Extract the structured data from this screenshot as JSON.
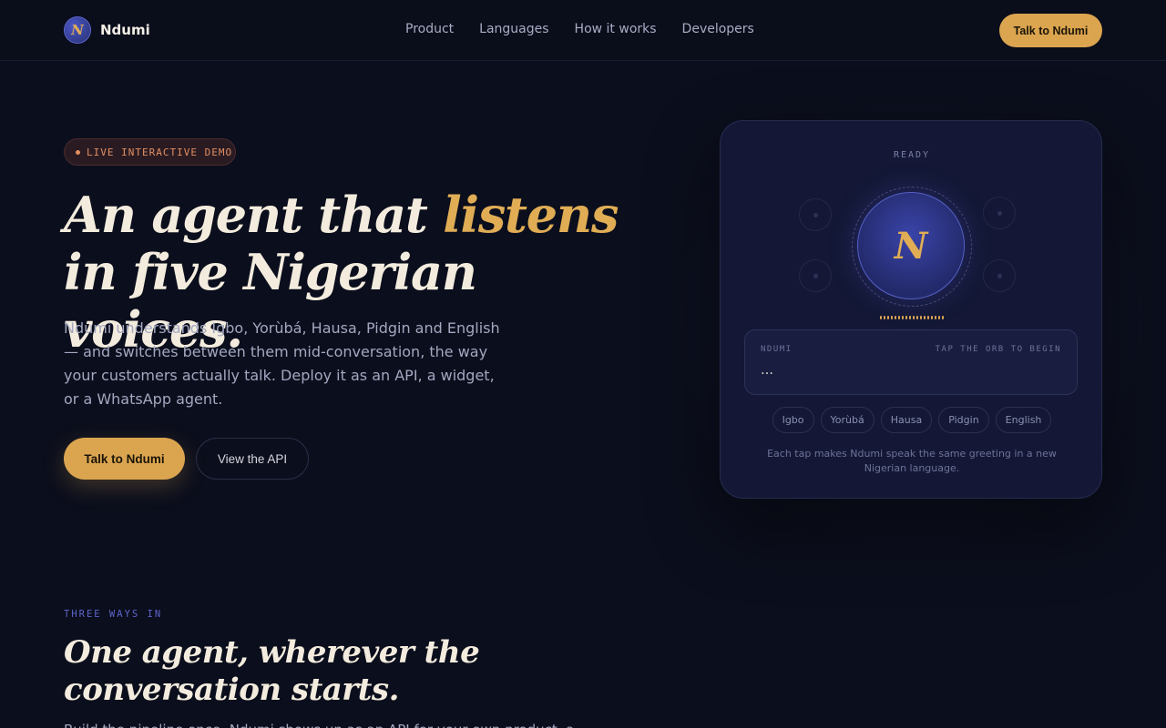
{
  "header": {
    "brand_logo_letter": "N",
    "brand_name": "Ndumi",
    "nav": [
      "Product",
      "Languages",
      "How it works",
      "Developers"
    ],
    "cta_label": "Talk to Ndumi"
  },
  "hero": {
    "badge": "LIVE INTERACTIVE DEMO",
    "title_part1": "An agent that ",
    "title_accent": "listens",
    "title_part2": "in five Nigerian voices.",
    "description": "Ndumi understands Igbo, Yorùbá, Hausa, Pidgin and English — and switches between them mid-conversation, the way your customers actually talk. Deploy it as an API, a widget, or a WhatsApp agent.",
    "primary_button": "Talk to Ndumi",
    "secondary_button": "View the API"
  },
  "demo": {
    "status": "READY",
    "orb_letter": "N",
    "transcript_speaker": "NDUMI",
    "transcript_hint": "TAP THE ORB TO BEGIN",
    "transcript_text": "…",
    "languages": [
      "Igbo",
      "Yorùbá",
      "Hausa",
      "Pidgin",
      "English"
    ],
    "caption": "Each tap makes Ndumi speak the same greeting in a new Nigerian language."
  },
  "section": {
    "eyebrow": "THREE WAYS IN",
    "title_line1": "One agent, wherever the",
    "title_line2": "conversation starts.",
    "description": "Build the pipeline once. Ndumi shows up as an API for your own product, a"
  },
  "colors": {
    "background": "#0b0e1c",
    "accent_gold": "#dba550",
    "accent_indigo": "#5d66cc",
    "badge_text": "#e08f63"
  }
}
